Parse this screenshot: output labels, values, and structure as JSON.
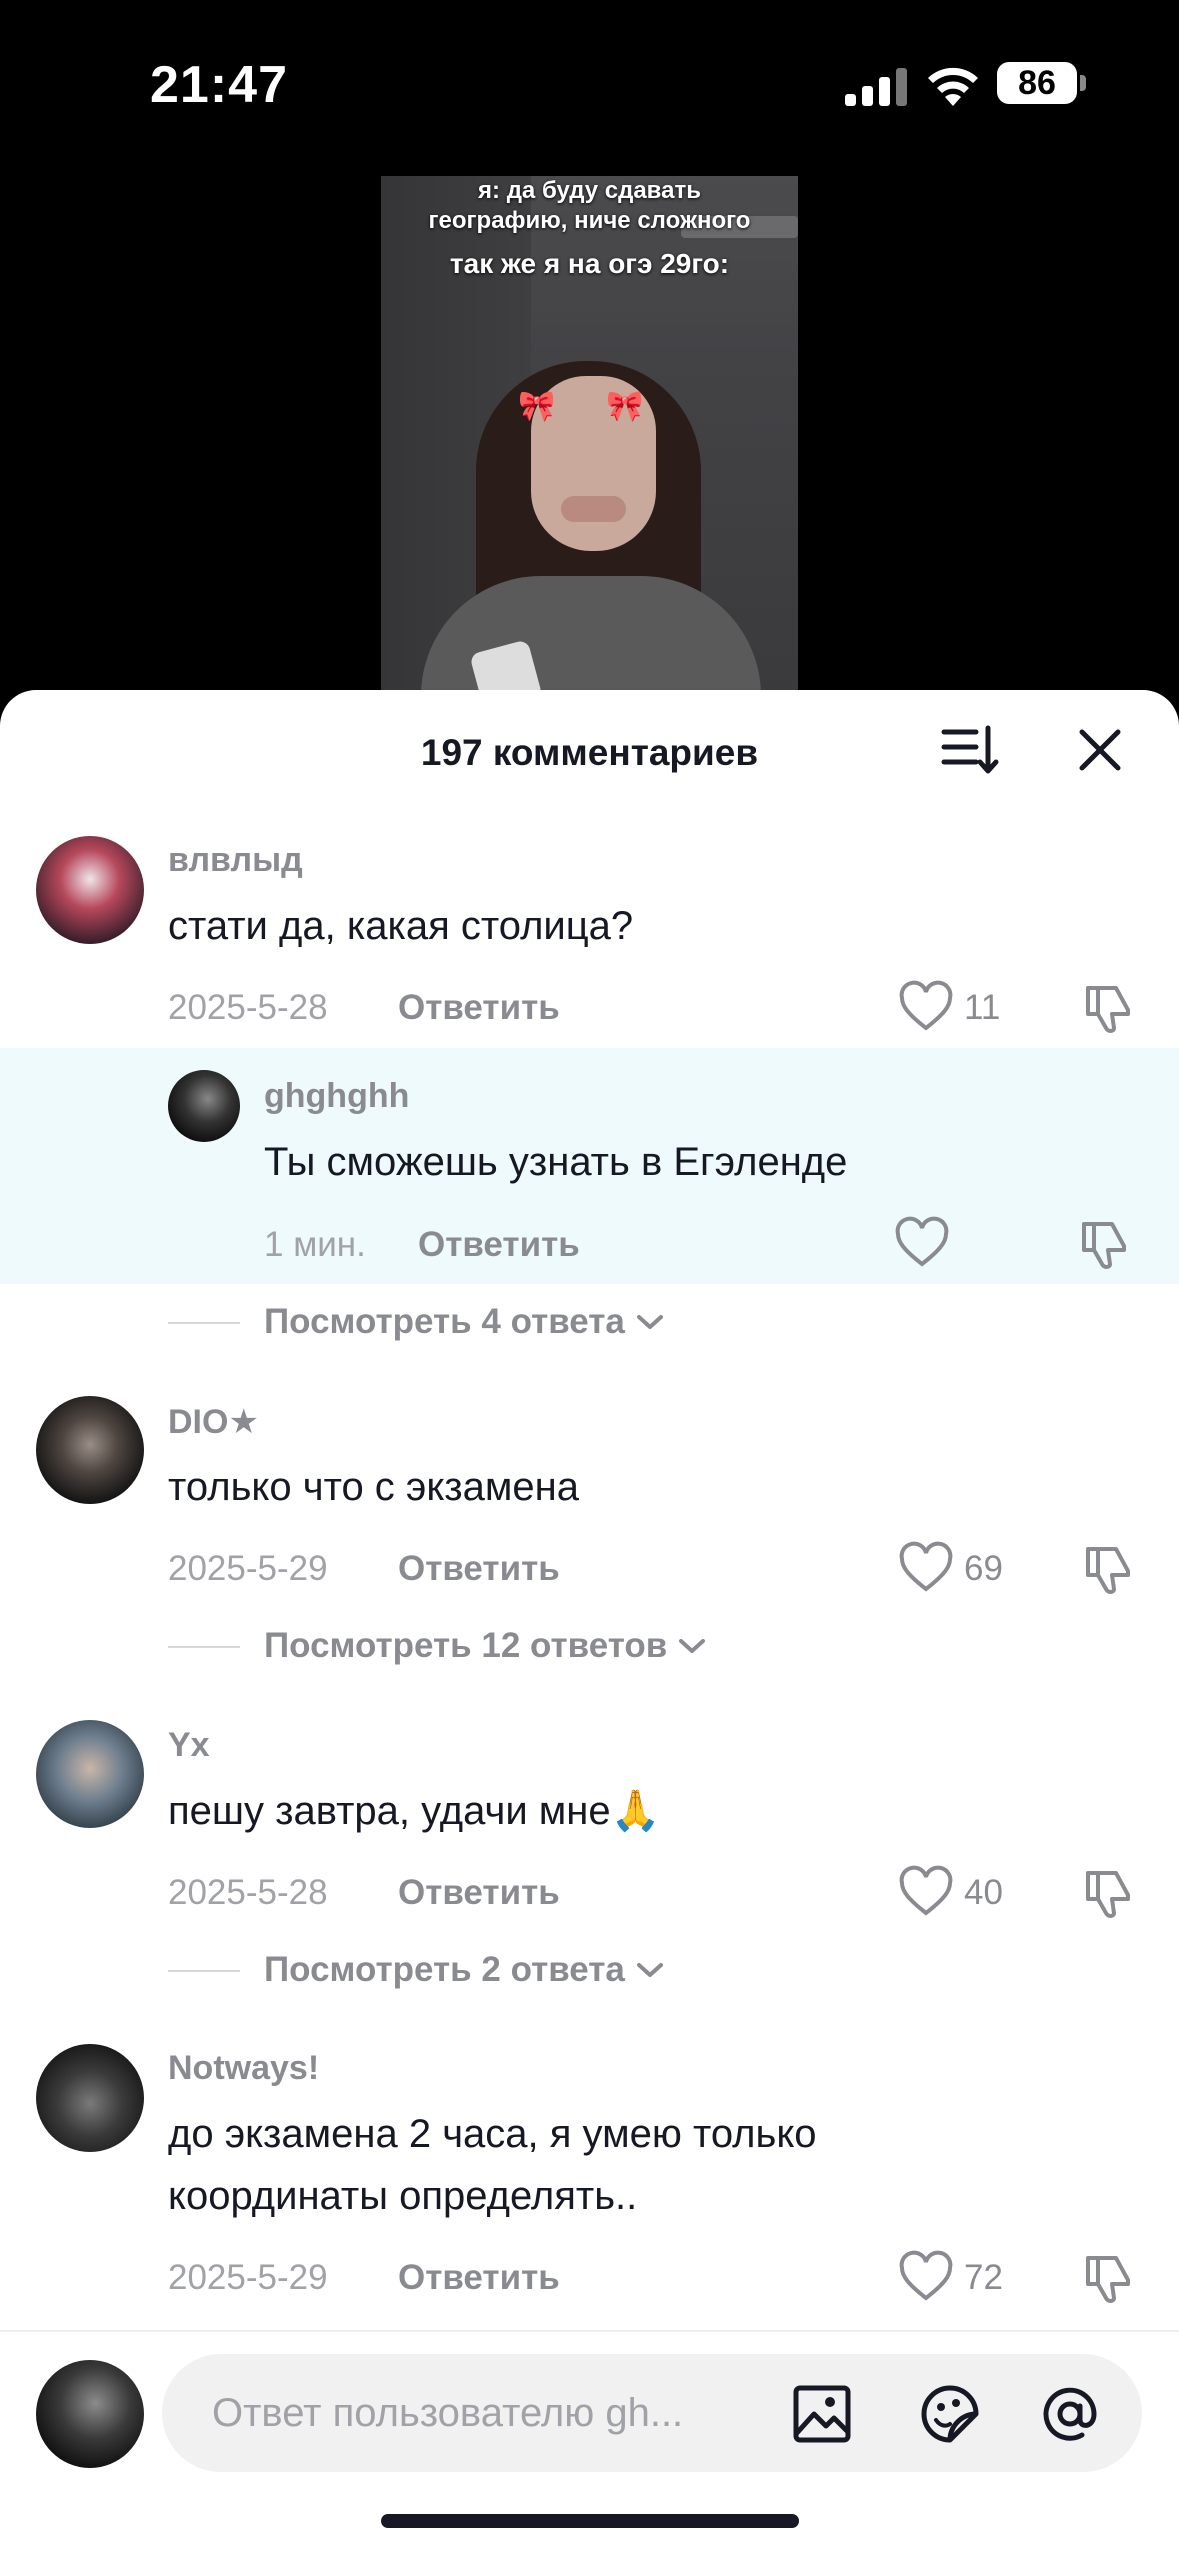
{
  "status_bar": {
    "time": "21:47",
    "battery": "86"
  },
  "video": {
    "caption_line1": "я: да буду сдавать",
    "caption_line2": "географию, ниче сложного",
    "caption_line3": "так же я на огэ 29го:"
  },
  "sheet": {
    "title": "197 комментариев"
  },
  "comments": [
    {
      "username": "влвлыд",
      "text": "стати да, какая столица?",
      "date": "2025-5-28",
      "reply_label": "Ответить",
      "likes": "11"
    },
    {
      "username": "ghghghh",
      "text": "Ты сможешь узнать в Егэленде",
      "date": "1 мин.",
      "reply_label": "Ответить",
      "likes": ""
    },
    {
      "username": "DIO★",
      "text": "только что с экзамена",
      "date": "2025-5-29",
      "reply_label": "Ответить",
      "likes": "69"
    },
    {
      "username": "Yx",
      "text": "пешу завтра, удачи мне🙏",
      "date": "2025-5-28",
      "reply_label": "Ответить",
      "likes": "40"
    },
    {
      "username": "Notways!",
      "text_line1": "до экзамена 2 часа, я умею только",
      "text_line2": "координаты определять..",
      "date": "2025-5-29",
      "reply_label": "Ответить",
      "likes": "72"
    }
  ],
  "view_replies": [
    "Посмотреть 4 ответа",
    "Посмотреть 12 ответов",
    "Посмотреть 2 ответа"
  ],
  "composer": {
    "placeholder": "Ответ пользователю gh..."
  },
  "colors": {
    "highlight": "#eefafc",
    "text_primary": "#161823",
    "text_secondary": "#8a8b91"
  }
}
